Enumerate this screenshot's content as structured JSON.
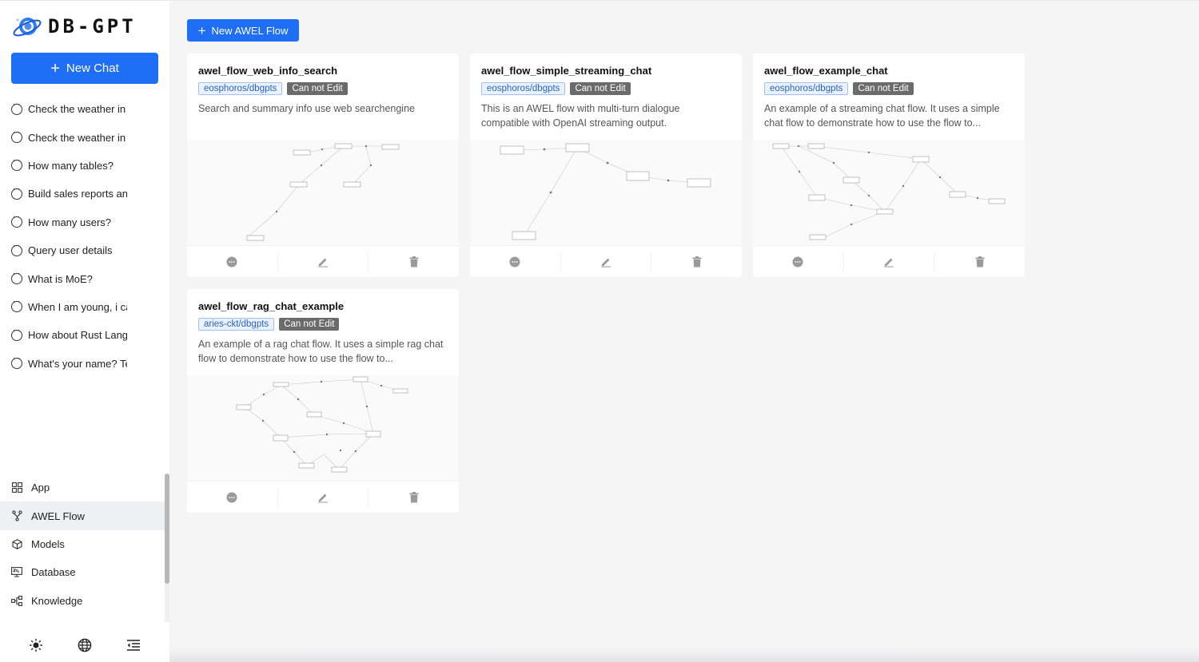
{
  "app": {
    "logo_text": "DB-GPT"
  },
  "sidebar": {
    "new_chat_label": "New Chat",
    "chats": [
      {
        "label": "Check the weather in"
      },
      {
        "label": "Check the weather in"
      },
      {
        "label": "How many tables?"
      },
      {
        "label": "Build sales reports an"
      },
      {
        "label": "How many users?"
      },
      {
        "label": "Query user details"
      },
      {
        "label": "What is MoE?"
      },
      {
        "label": "When I am young, i ca"
      },
      {
        "label": "How about Rust Langu"
      },
      {
        "label": "What's your name? Te"
      }
    ],
    "nav": [
      {
        "label": "App",
        "icon": "grid-icon"
      },
      {
        "label": "AWEL Flow",
        "icon": "flow-branch-icon",
        "active": true
      },
      {
        "label": "Models",
        "icon": "cube-icon"
      },
      {
        "label": "Database",
        "icon": "sql-monitor-icon"
      },
      {
        "label": "Knowledge",
        "icon": "knowledge-graph-icon"
      }
    ],
    "bottom_icons": [
      "sun-icon",
      "globe-icon",
      "collapse-menu-icon"
    ]
  },
  "main": {
    "new_flow_label": "New AWEL Flow",
    "cards": [
      {
        "title": "awel_flow_web_info_search",
        "owner": "eosphoros/dbgpts",
        "edit_status": "Can not Edit",
        "description": "Search and summary info use web searchengine"
      },
      {
        "title": "awel_flow_simple_streaming_chat",
        "owner": "eosphoros/dbgpts",
        "edit_status": "Can not Edit",
        "description": "This is an AWEL flow with multi-turn dialogue compatible with OpenAI streaming output."
      },
      {
        "title": "awel_flow_example_chat",
        "owner": "eosphoros/dbgpts",
        "edit_status": "Can not Edit",
        "description": "An example of a streaming chat flow. It uses a simple chat flow to demonstrate how to use the flow to..."
      },
      {
        "title": "awel_flow_rag_chat_example",
        "owner": "aries-ckt/dbgpts",
        "edit_status": "Can not Edit",
        "description": "An example of a rag chat flow. It uses a simple rag chat flow to demonstrate how to use the flow to..."
      }
    ],
    "card_actions": [
      "chat-icon",
      "edit-icon",
      "delete-icon"
    ]
  },
  "colors": {
    "accent": "#1e6ff5",
    "tag_owner_bg": "#eaf2ff",
    "tag_edit_bg": "#6b6b6b",
    "page_bg": "#f5f5f6"
  }
}
